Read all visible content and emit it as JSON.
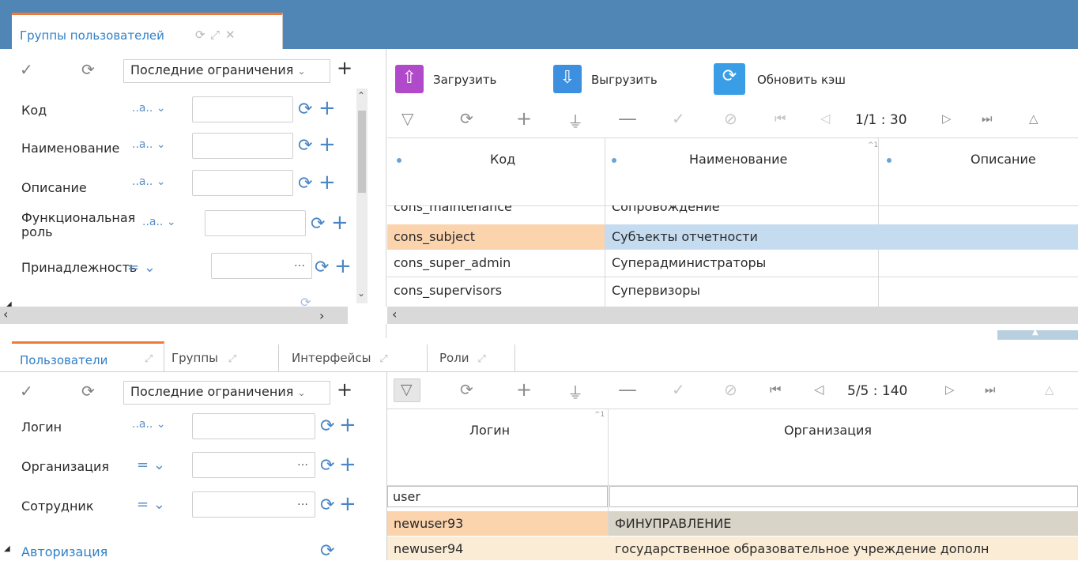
{
  "top": {
    "tab_title": "Группы пользователей",
    "filter": {
      "preset": "Последние ограничения",
      "fields": [
        {
          "label": "Код",
          "op": "..a..",
          "value": ""
        },
        {
          "label": "Наименование",
          "op": "..a..",
          "value": ""
        },
        {
          "label": "Описание",
          "op": "..a..",
          "value": ""
        },
        {
          "label": "Функциональная",
          "label2": "роль",
          "op": "..a..",
          "value": ""
        },
        {
          "label": "Принадлежность",
          "op": "=",
          "value": ""
        }
      ]
    },
    "toolbar": {
      "upload": "Загрузить",
      "download": "Выгрузить",
      "refresh_cache": "Обновить кэш"
    },
    "pager": "1/1 : 30",
    "columns": [
      "Код",
      "Наименование",
      "Описание"
    ],
    "rows": [
      {
        "code": "cons_maintenance",
        "name": "Сопровождение",
        "desc": ""
      },
      {
        "code": "cons_subject",
        "name": "Субъекты отчетности",
        "desc": ""
      },
      {
        "code": "cons_super_admin",
        "name": "Суперадминистраторы",
        "desc": ""
      },
      {
        "code": "cons_supervisors",
        "name": "Супервизоры",
        "desc": ""
      }
    ]
  },
  "bottom": {
    "tabs": [
      "Пользователи",
      "Группы",
      "Интерфейсы",
      "Роли"
    ],
    "filter": {
      "preset": "Последние ограничения",
      "fields": [
        {
          "label": "Логин",
          "op": "..a..",
          "value": ""
        },
        {
          "label": "Организация",
          "op": "=",
          "value": ""
        },
        {
          "label": "Сотрудник",
          "op": "=",
          "value": ""
        }
      ],
      "group": "Авторизация"
    },
    "pager": "5/5 : 140",
    "columns": [
      "Логин",
      "Организация"
    ],
    "filter_row": {
      "login": "user",
      "org": ""
    },
    "rows": [
      {
        "login": "newuser93",
        "org": "ФИНУПРАВЛЕНИЕ"
      },
      {
        "login": "newuser94",
        "org": "государственное образовательное учреждение дополн"
      }
    ]
  },
  "colors": {
    "header_blue": "#4f86b6",
    "accent_orange": "#f07a3a",
    "selected_row": "#c5dcf0",
    "selected_cell": "#fbd3ad",
    "org_row1": "#d8d5c8",
    "org_row2": "#fbecd6"
  }
}
